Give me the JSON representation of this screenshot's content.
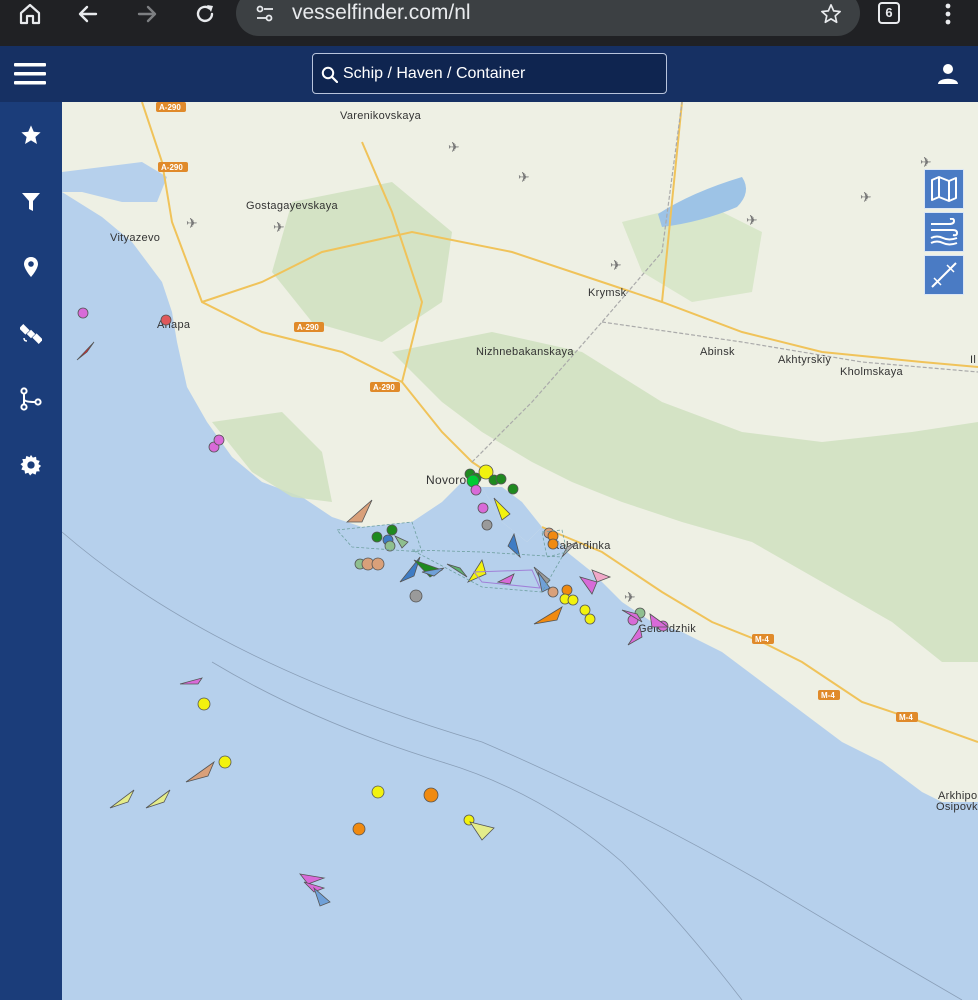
{
  "browser": {
    "url": "vesselfinder.com/nl",
    "tab_count": "6"
  },
  "header": {
    "search_placeholder": "Schip / Haven / Container"
  },
  "sidebar": {
    "items": [
      "star-icon",
      "filter-icon",
      "map-pin-icon",
      "satellite-icon",
      "route-icon",
      "settings-icon"
    ]
  },
  "map": {
    "places": [
      "Varenikovskaya",
      "Gostagayevskaya",
      "Vityazevo",
      "Anapa",
      "Krymsk",
      "Nizhnebakanskaya",
      "Abinsk",
      "Akhtyrskiy",
      "Kholmskaya",
      "Il",
      "Novoros",
      "Kabardinka",
      "Gelendzhik",
      "Arkhipo",
      "Osipovk"
    ],
    "roads": [
      "A-290",
      "M-4"
    ],
    "layer_controls": [
      "map-layers-icon",
      "wind-icon",
      "route-tool-icon"
    ]
  },
  "colors": {
    "header": "#163063",
    "sidebar": "#1b3d7a",
    "sea": "#b6d0ec",
    "land": "#eef0e4",
    "vessel_yellow": "#f2f20f",
    "vessel_green": "#1f8a1f",
    "vessel_orange": "#f08a10",
    "vessel_magenta": "#d86ad8",
    "vessel_grey": "#9a9a9a",
    "vessel_blue": "#3f7cc4"
  }
}
